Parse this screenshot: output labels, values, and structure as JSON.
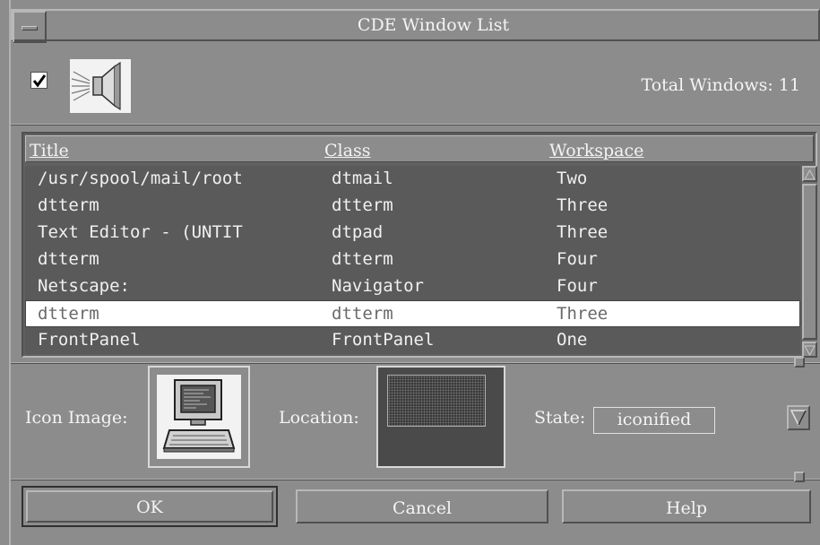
{
  "window": {
    "title": "CDE Window List"
  },
  "top": {
    "show_checkbox_checked": true,
    "total_label": "Total Windows: 11",
    "speaker_icon": "speaker-icon"
  },
  "list": {
    "headers": [
      "Title",
      "Class",
      "Workspace"
    ],
    "rows": [
      {
        "title": "/usr/spool/mail/root",
        "class": "dtmail",
        "workspace": "Two"
      },
      {
        "title": "dtterm",
        "class": "dtterm",
        "workspace": "Three"
      },
      {
        "title": "Text Editor - (UNTIT",
        "class": "dtpad",
        "workspace": "Three"
      },
      {
        "title": "dtterm",
        "class": "dtterm",
        "workspace": "Four"
      },
      {
        "title": "Netscape:",
        "class": "Navigator",
        "workspace": "Four"
      },
      {
        "title": "dtterm",
        "class": "dtterm",
        "workspace": "Three",
        "selected": true
      },
      {
        "title": "FrontPanel",
        "class": "FrontPanel",
        "workspace": "One"
      }
    ]
  },
  "details": {
    "icon_label": "Icon Image:",
    "icon_image": "terminal-computer-icon",
    "location_label": "Location:",
    "state_label": "State:",
    "state_value": "iconified"
  },
  "buttons": {
    "ok": "OK",
    "cancel": "Cancel",
    "help": "Help"
  },
  "colors": {
    "background": "#8c8c8c",
    "list_bg": "#5a5a5a",
    "selected_bg": "#ffffff"
  }
}
